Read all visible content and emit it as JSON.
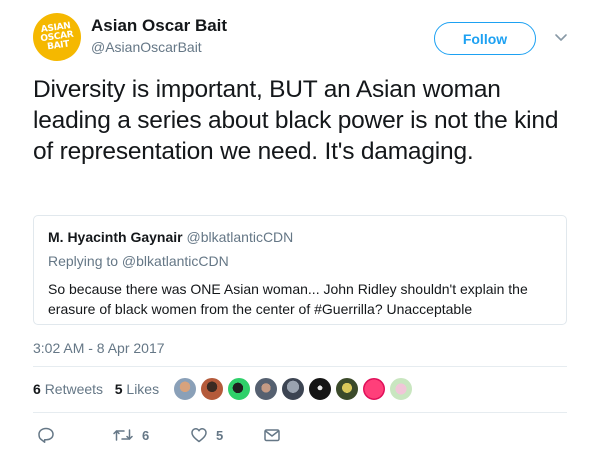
{
  "account": {
    "name": "Asian Oscar Bait",
    "handle": "@AsianOscarBait",
    "logo_lines": [
      "ASIAN",
      "OSCAR",
      "BAIT"
    ],
    "follow_label": "Follow"
  },
  "tweet": {
    "text": "Diversity is important, BUT an Asian woman leading a series about black power is not the kind of representation we need. It's damaging.",
    "timestamp": "3:02 AM - 8 Apr 2017"
  },
  "quoted": {
    "name": "M. Hyacinth Gaynair",
    "handle": "@blkatlanticCDN",
    "replying_to": "Replying to @blkatlanticCDN",
    "text": "So because there was ONE Asian woman... John Ridley shouldn't explain the erasure of black women from the center of #Guerrilla? Unacceptable"
  },
  "stats": {
    "retweets_count": "6",
    "retweets_label": "Retweets",
    "likes_count": "5",
    "likes_label": "Likes"
  },
  "actions": {
    "reply_icon": "reply-icon",
    "retweet_icon": "retweet-icon",
    "retweet_count": "6",
    "like_icon": "heart-icon",
    "like_count": "5",
    "dm_icon": "envelope-icon"
  },
  "colors": {
    "accent": "#1da1f2",
    "muted": "#657786",
    "logo": "#f5b800"
  }
}
